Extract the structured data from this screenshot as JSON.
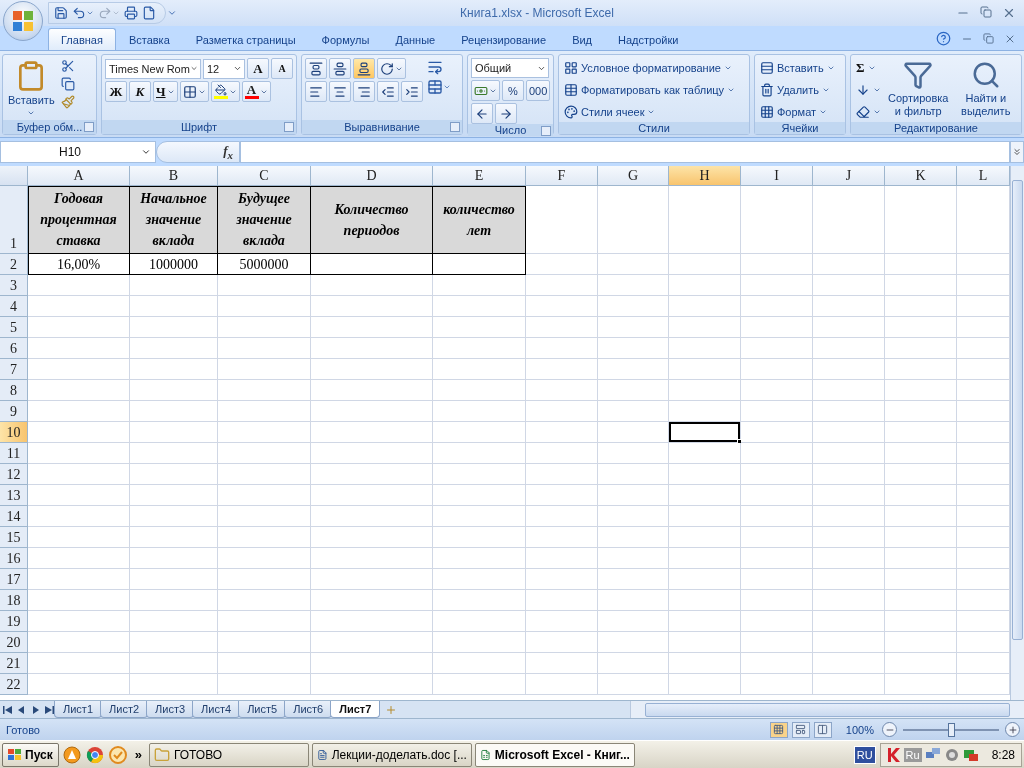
{
  "window": {
    "title": "Книга1.xlsx - Microsoft Excel"
  },
  "ribbon_tabs": [
    {
      "label": "Главная",
      "selected": true
    },
    {
      "label": "Вставка",
      "selected": false
    },
    {
      "label": "Разметка страницы",
      "selected": false
    },
    {
      "label": "Формулы",
      "selected": false
    },
    {
      "label": "Данные",
      "selected": false
    },
    {
      "label": "Рецензирование",
      "selected": false
    },
    {
      "label": "Вид",
      "selected": false
    },
    {
      "label": "Надстройки",
      "selected": false
    }
  ],
  "ribbon_groups": [
    {
      "kind": "clipboard",
      "label": "Буфер обм...",
      "launcher": true,
      "paste": "Вставить"
    },
    {
      "kind": "font",
      "label": "Шрифт",
      "launcher": true,
      "font_name": "Times New Rom",
      "font_size": "12",
      "grow": "A",
      "shrink": "A",
      "bold": "Ж",
      "italic": "К",
      "underline": "Ч",
      "font_color": "A"
    },
    {
      "kind": "alignment",
      "label": "Выравнивание",
      "launcher": true,
      "vertical_align": [
        {
          "selected": false
        },
        {
          "selected": false
        },
        {
          "selected": true
        }
      ]
    },
    {
      "kind": "number",
      "label": "Число",
      "launcher": true,
      "format": "Общий",
      "percent": "%",
      "thousands": "000"
    },
    {
      "kind": "styles",
      "label": "Стили",
      "launcher": false,
      "items": [
        "Условное форматирование",
        "Форматировать как таблицу",
        "Стили ячеек"
      ]
    },
    {
      "kind": "cells",
      "label": "Ячейки",
      "launcher": false,
      "items": [
        "Вставить",
        "Удалить",
        "Формат"
      ]
    },
    {
      "kind": "editing",
      "label": "Редактирование",
      "launcher": false,
      "sum": "Σ",
      "items": [
        "Сортировка и фильтр",
        "Найти и выделить"
      ]
    }
  ],
  "formula_bar": {
    "name_box": "H10",
    "function_label": "f$_{x}$"
  },
  "columns": [
    {
      "label": "A",
      "selected": false
    },
    {
      "label": "B",
      "selected": false
    },
    {
      "label": "C",
      "selected": false
    },
    {
      "label": "D",
      "selected": false
    },
    {
      "label": "E",
      "selected": false
    },
    {
      "label": "F",
      "selected": false
    },
    {
      "label": "G",
      "selected": false
    },
    {
      "label": "H",
      "selected": true
    },
    {
      "label": "I",
      "selected": false
    },
    {
      "label": "J",
      "selected": false
    },
    {
      "label": "K",
      "selected": false
    },
    {
      "label": "L",
      "selected": false
    }
  ],
  "rows": [
    {
      "label": "1",
      "selected": false,
      "kind": "header",
      "cells": [
        {
          "text": "Годовая процентная ставка"
        },
        {
          "text": "Начальное значение вклада"
        },
        {
          "text": "Будущее значение вклада"
        },
        {
          "text": "Количество периодов"
        },
        {
          "text": "количество лет"
        }
      ]
    },
    {
      "label": "2",
      "selected": false,
      "kind": "data",
      "cells": [
        {
          "text": "16,00%"
        },
        {
          "text": "1000000"
        },
        {
          "text": "5000000"
        },
        {},
        {}
      ]
    },
    {
      "label": "3",
      "selected": false,
      "kind": "empty"
    },
    {
      "label": "4",
      "selected": false,
      "kind": "empty"
    },
    {
      "label": "5",
      "selected": false,
      "kind": "empty"
    },
    {
      "label": "6",
      "selected": false,
      "kind": "empty"
    },
    {
      "label": "7",
      "selected": false,
      "kind": "empty"
    },
    {
      "label": "8",
      "selected": false,
      "kind": "empty"
    },
    {
      "label": "9",
      "selected": false,
      "kind": "empty"
    },
    {
      "label": "10",
      "selected": true,
      "kind": "empty"
    },
    {
      "label": "11",
      "selected": false,
      "kind": "empty"
    },
    {
      "label": "12",
      "selected": false,
      "kind": "empty"
    },
    {
      "label": "13",
      "selected": false,
      "kind": "empty"
    },
    {
      "label": "14",
      "selected": false,
      "kind": "empty"
    },
    {
      "label": "15",
      "selected": false,
      "kind": "empty"
    },
    {
      "label": "16",
      "selected": false,
      "kind": "empty"
    },
    {
      "label": "17",
      "selected": false,
      "kind": "empty"
    },
    {
      "label": "18",
      "selected": false,
      "kind": "empty"
    },
    {
      "label": "19",
      "selected": false,
      "kind": "empty"
    },
    {
      "label": "20",
      "selected": false,
      "kind": "empty"
    },
    {
      "label": "21",
      "selected": false,
      "kind": "empty"
    },
    {
      "label": "22",
      "selected": false,
      "kind": "empty"
    }
  ],
  "sheets": [
    {
      "label": "Лист1",
      "selected": false
    },
    {
      "label": "Лист2",
      "selected": false
    },
    {
      "label": "Лист3",
      "selected": false
    },
    {
      "label": "Лист4",
      "selected": false
    },
    {
      "label": "Лист5",
      "selected": false
    },
    {
      "label": "Лист6",
      "selected": false
    },
    {
      "label": "Лист7",
      "selected": true
    }
  ],
  "status_bar": {
    "text": "Готово",
    "views": [
      {
        "selected": true
      },
      {
        "selected": false
      },
      {
        "selected": false
      }
    ],
    "zoom": "100%",
    "zoom_slider": {
      "level": 0.5
    }
  },
  "taskbar": {
    "start": "Пуск",
    "more": "»",
    "tasks": [
      {
        "kind": "folder",
        "label": "ГОТОВО",
        "selected": false
      },
      {
        "kind": "word",
        "label": "Лекции-доделать.doc [...",
        "selected": false
      },
      {
        "kind": "excel",
        "label": "Microsoft Excel - Книг...",
        "selected": true
      }
    ],
    "language": "RU",
    "tray_language": "Ru",
    "clock": "8:28"
  }
}
